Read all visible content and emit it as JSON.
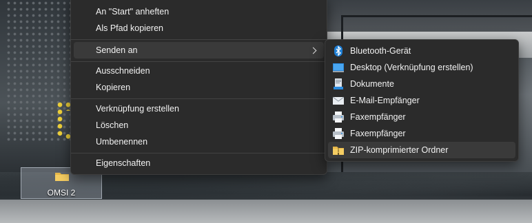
{
  "desktop": {
    "icon": {
      "label": "OMSI 2",
      "icon": "folder-icon"
    }
  },
  "context_menu": {
    "items": [
      {
        "label": "An \"Start\" anheften"
      },
      {
        "label": "Als Pfad kopieren"
      },
      {
        "label": "Senden an",
        "has_submenu": true
      },
      {
        "label": "Ausschneiden"
      },
      {
        "label": "Kopieren"
      },
      {
        "label": "Verknüpfung erstellen"
      },
      {
        "label": "Löschen"
      },
      {
        "label": "Umbenennen"
      },
      {
        "label": "Eigenschaften"
      }
    ]
  },
  "send_to_menu": {
    "items": [
      {
        "label": "Bluetooth-Gerät",
        "icon": "bluetooth-icon"
      },
      {
        "label": "Desktop (Verknüpfung erstellen)",
        "icon": "desktop-icon"
      },
      {
        "label": "Dokumente",
        "icon": "documents-icon"
      },
      {
        "label": "E-Mail-Empfänger",
        "icon": "mail-recipient-icon"
      },
      {
        "label": "Faxempfänger",
        "icon": "fax-icon"
      },
      {
        "label": "Faxempfänger",
        "icon": "fax-icon"
      },
      {
        "label": "ZIP-komprimierter Ordner",
        "icon": "zip-folder-icon"
      }
    ]
  },
  "colors": {
    "menu_bg": "#2b2b2b",
    "menu_hover": "#3a3a3a",
    "accent_blue": "#1e7fd6",
    "folder_yellow": "#e8b84a"
  }
}
